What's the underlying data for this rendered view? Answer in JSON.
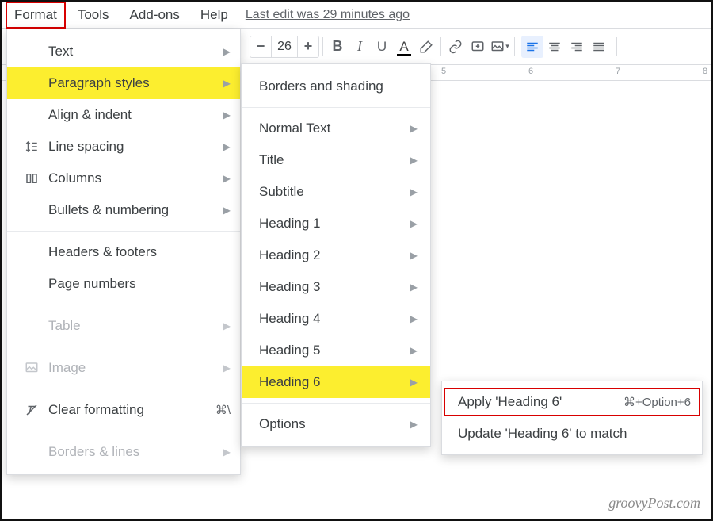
{
  "menubar": {
    "items": [
      "Format",
      "Tools",
      "Add-ons",
      "Help"
    ],
    "last_edit": "Last edit was 29 minutes ago"
  },
  "toolbar": {
    "font_size": "26",
    "bold": "B",
    "italic": "I",
    "underline": "U",
    "textcolor": "A"
  },
  "ruler": {
    "labels": [
      "5",
      "6",
      "7",
      "8"
    ]
  },
  "format_menu": {
    "items": [
      {
        "label": "Text",
        "arrow": true
      },
      {
        "label": "Paragraph styles",
        "arrow": true,
        "highlight": true
      },
      {
        "label": "Align & indent",
        "arrow": true
      },
      {
        "label": "Line spacing",
        "arrow": true,
        "icon": "line-spacing"
      },
      {
        "label": "Columns",
        "arrow": true,
        "icon": "columns"
      },
      {
        "label": "Bullets & numbering",
        "arrow": true
      },
      {
        "divider": true
      },
      {
        "label": "Headers & footers"
      },
      {
        "label": "Page numbers"
      },
      {
        "divider": true
      },
      {
        "label": "Table",
        "arrow": true,
        "disabled": true
      },
      {
        "divider": true
      },
      {
        "label": "Image",
        "arrow": true,
        "disabled": true,
        "icon": "image"
      },
      {
        "divider": true
      },
      {
        "label": "Clear formatting",
        "shortcut": "⌘\\",
        "icon": "clear-format"
      },
      {
        "divider": true
      },
      {
        "label": "Borders & lines",
        "arrow": true,
        "disabled": true
      }
    ]
  },
  "paragraph_styles_menu": {
    "items": [
      {
        "label": "Borders and shading"
      },
      {
        "divider": true
      },
      {
        "label": "Normal Text",
        "arrow": true
      },
      {
        "label": "Title",
        "arrow": true
      },
      {
        "label": "Subtitle",
        "arrow": true
      },
      {
        "label": "Heading 1",
        "arrow": true
      },
      {
        "label": "Heading 2",
        "arrow": true
      },
      {
        "label": "Heading 3",
        "arrow": true
      },
      {
        "label": "Heading 4",
        "arrow": true
      },
      {
        "label": "Heading 5",
        "arrow": true
      },
      {
        "label": "Heading 6",
        "arrow": true,
        "highlight": true
      },
      {
        "divider": true
      },
      {
        "label": "Options",
        "arrow": true
      }
    ]
  },
  "heading6_menu": {
    "items": [
      {
        "label": "Apply 'Heading 6'",
        "shortcut": "⌘+Option+6",
        "boxed": true
      },
      {
        "label": "Update 'Heading 6' to match"
      }
    ]
  },
  "watermark": "groovyPost.com"
}
